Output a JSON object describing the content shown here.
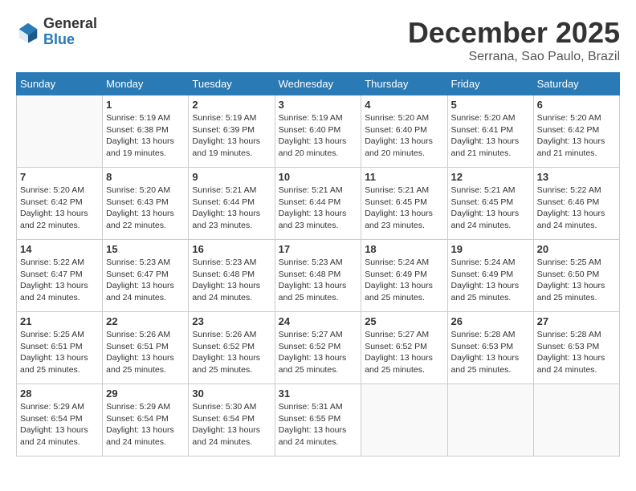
{
  "logo": {
    "general": "General",
    "blue": "Blue"
  },
  "title": {
    "month_year": "December 2025",
    "location": "Serrana, Sao Paulo, Brazil"
  },
  "days_header": [
    "Sunday",
    "Monday",
    "Tuesday",
    "Wednesday",
    "Thursday",
    "Friday",
    "Saturday"
  ],
  "weeks": [
    [
      {
        "day": "",
        "sunrise": "",
        "sunset": "",
        "daylight": ""
      },
      {
        "day": "1",
        "sunrise": "Sunrise: 5:19 AM",
        "sunset": "Sunset: 6:38 PM",
        "daylight": "Daylight: 13 hours and 19 minutes."
      },
      {
        "day": "2",
        "sunrise": "Sunrise: 5:19 AM",
        "sunset": "Sunset: 6:39 PM",
        "daylight": "Daylight: 13 hours and 19 minutes."
      },
      {
        "day": "3",
        "sunrise": "Sunrise: 5:19 AM",
        "sunset": "Sunset: 6:40 PM",
        "daylight": "Daylight: 13 hours and 20 minutes."
      },
      {
        "day": "4",
        "sunrise": "Sunrise: 5:20 AM",
        "sunset": "Sunset: 6:40 PM",
        "daylight": "Daylight: 13 hours and 20 minutes."
      },
      {
        "day": "5",
        "sunrise": "Sunrise: 5:20 AM",
        "sunset": "Sunset: 6:41 PM",
        "daylight": "Daylight: 13 hours and 21 minutes."
      },
      {
        "day": "6",
        "sunrise": "Sunrise: 5:20 AM",
        "sunset": "Sunset: 6:42 PM",
        "daylight": "Daylight: 13 hours and 21 minutes."
      }
    ],
    [
      {
        "day": "7",
        "sunrise": "Sunrise: 5:20 AM",
        "sunset": "Sunset: 6:42 PM",
        "daylight": "Daylight: 13 hours and 22 minutes."
      },
      {
        "day": "8",
        "sunrise": "Sunrise: 5:20 AM",
        "sunset": "Sunset: 6:43 PM",
        "daylight": "Daylight: 13 hours and 22 minutes."
      },
      {
        "day": "9",
        "sunrise": "Sunrise: 5:21 AM",
        "sunset": "Sunset: 6:44 PM",
        "daylight": "Daylight: 13 hours and 23 minutes."
      },
      {
        "day": "10",
        "sunrise": "Sunrise: 5:21 AM",
        "sunset": "Sunset: 6:44 PM",
        "daylight": "Daylight: 13 hours and 23 minutes."
      },
      {
        "day": "11",
        "sunrise": "Sunrise: 5:21 AM",
        "sunset": "Sunset: 6:45 PM",
        "daylight": "Daylight: 13 hours and 23 minutes."
      },
      {
        "day": "12",
        "sunrise": "Sunrise: 5:21 AM",
        "sunset": "Sunset: 6:45 PM",
        "daylight": "Daylight: 13 hours and 24 minutes."
      },
      {
        "day": "13",
        "sunrise": "Sunrise: 5:22 AM",
        "sunset": "Sunset: 6:46 PM",
        "daylight": "Daylight: 13 hours and 24 minutes."
      }
    ],
    [
      {
        "day": "14",
        "sunrise": "Sunrise: 5:22 AM",
        "sunset": "Sunset: 6:47 PM",
        "daylight": "Daylight: 13 hours and 24 minutes."
      },
      {
        "day": "15",
        "sunrise": "Sunrise: 5:23 AM",
        "sunset": "Sunset: 6:47 PM",
        "daylight": "Daylight: 13 hours and 24 minutes."
      },
      {
        "day": "16",
        "sunrise": "Sunrise: 5:23 AM",
        "sunset": "Sunset: 6:48 PM",
        "daylight": "Daylight: 13 hours and 24 minutes."
      },
      {
        "day": "17",
        "sunrise": "Sunrise: 5:23 AM",
        "sunset": "Sunset: 6:48 PM",
        "daylight": "Daylight: 13 hours and 25 minutes."
      },
      {
        "day": "18",
        "sunrise": "Sunrise: 5:24 AM",
        "sunset": "Sunset: 6:49 PM",
        "daylight": "Daylight: 13 hours and 25 minutes."
      },
      {
        "day": "19",
        "sunrise": "Sunrise: 5:24 AM",
        "sunset": "Sunset: 6:49 PM",
        "daylight": "Daylight: 13 hours and 25 minutes."
      },
      {
        "day": "20",
        "sunrise": "Sunrise: 5:25 AM",
        "sunset": "Sunset: 6:50 PM",
        "daylight": "Daylight: 13 hours and 25 minutes."
      }
    ],
    [
      {
        "day": "21",
        "sunrise": "Sunrise: 5:25 AM",
        "sunset": "Sunset: 6:51 PM",
        "daylight": "Daylight: 13 hours and 25 minutes."
      },
      {
        "day": "22",
        "sunrise": "Sunrise: 5:26 AM",
        "sunset": "Sunset: 6:51 PM",
        "daylight": "Daylight: 13 hours and 25 minutes."
      },
      {
        "day": "23",
        "sunrise": "Sunrise: 5:26 AM",
        "sunset": "Sunset: 6:52 PM",
        "daylight": "Daylight: 13 hours and 25 minutes."
      },
      {
        "day": "24",
        "sunrise": "Sunrise: 5:27 AM",
        "sunset": "Sunset: 6:52 PM",
        "daylight": "Daylight: 13 hours and 25 minutes."
      },
      {
        "day": "25",
        "sunrise": "Sunrise: 5:27 AM",
        "sunset": "Sunset: 6:52 PM",
        "daylight": "Daylight: 13 hours and 25 minutes."
      },
      {
        "day": "26",
        "sunrise": "Sunrise: 5:28 AM",
        "sunset": "Sunset: 6:53 PM",
        "daylight": "Daylight: 13 hours and 25 minutes."
      },
      {
        "day": "27",
        "sunrise": "Sunrise: 5:28 AM",
        "sunset": "Sunset: 6:53 PM",
        "daylight": "Daylight: 13 hours and 24 minutes."
      }
    ],
    [
      {
        "day": "28",
        "sunrise": "Sunrise: 5:29 AM",
        "sunset": "Sunset: 6:54 PM",
        "daylight": "Daylight: 13 hours and 24 minutes."
      },
      {
        "day": "29",
        "sunrise": "Sunrise: 5:29 AM",
        "sunset": "Sunset: 6:54 PM",
        "daylight": "Daylight: 13 hours and 24 minutes."
      },
      {
        "day": "30",
        "sunrise": "Sunrise: 5:30 AM",
        "sunset": "Sunset: 6:54 PM",
        "daylight": "Daylight: 13 hours and 24 minutes."
      },
      {
        "day": "31",
        "sunrise": "Sunrise: 5:31 AM",
        "sunset": "Sunset: 6:55 PM",
        "daylight": "Daylight: 13 hours and 24 minutes."
      },
      {
        "day": "",
        "sunrise": "",
        "sunset": "",
        "daylight": ""
      },
      {
        "day": "",
        "sunrise": "",
        "sunset": "",
        "daylight": ""
      },
      {
        "day": "",
        "sunrise": "",
        "sunset": "",
        "daylight": ""
      }
    ]
  ]
}
